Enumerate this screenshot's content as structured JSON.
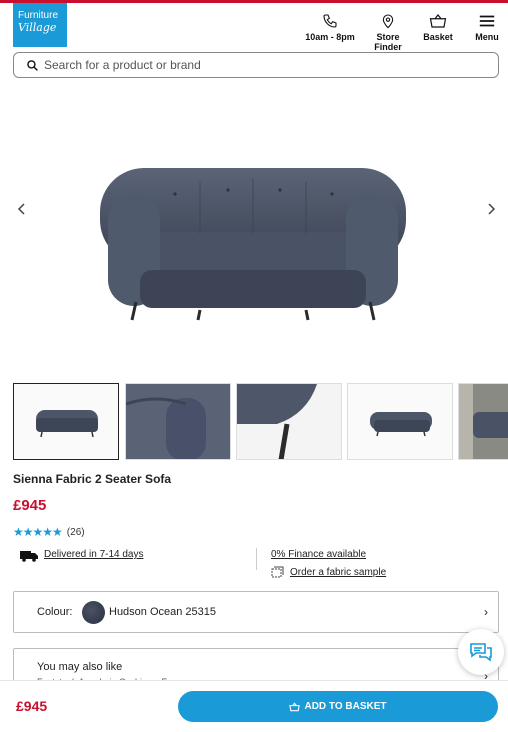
{
  "brand": {
    "logo_line1": "Furniture",
    "logo_line2": "Village",
    "accent": "#c8102e",
    "blue": "#1a9ad6"
  },
  "nav": {
    "hours": {
      "label": "10am - 8pm",
      "icon": "phone-icon"
    },
    "store_finder": {
      "label": "Store Finder",
      "icon": "location-pin-icon"
    },
    "basket": {
      "label": "Basket",
      "icon": "basket-icon"
    },
    "menu": {
      "label": "Menu",
      "icon": "hamburger-icon"
    }
  },
  "search": {
    "placeholder": "Search for a product or brand",
    "icon": "search-icon"
  },
  "product": {
    "name": "Sienna Fabric 2 Seater Sofa",
    "price": "£945",
    "rating": {
      "stars": "★★★★★",
      "value": 4.5,
      "count": "(26)"
    },
    "delivery": "Delivered in 7-14 days",
    "finance": "0% Finance available",
    "sample": "Order a fabric sample"
  },
  "thumbnails": [
    "Sofa front view",
    "Arm detail",
    "Leg detail",
    "Sofa three-quarter view",
    "Room setting"
  ],
  "colour": {
    "label": "Colour:",
    "value": "Hudson Ocean 25315",
    "swatch_hex": "#3a4152"
  },
  "also_like": {
    "label": "You may also like",
    "sub": "Footstool, Armchair, Cushions, Fo..."
  },
  "bottom": {
    "price": "£945",
    "button": "ADD TO BASKET"
  }
}
